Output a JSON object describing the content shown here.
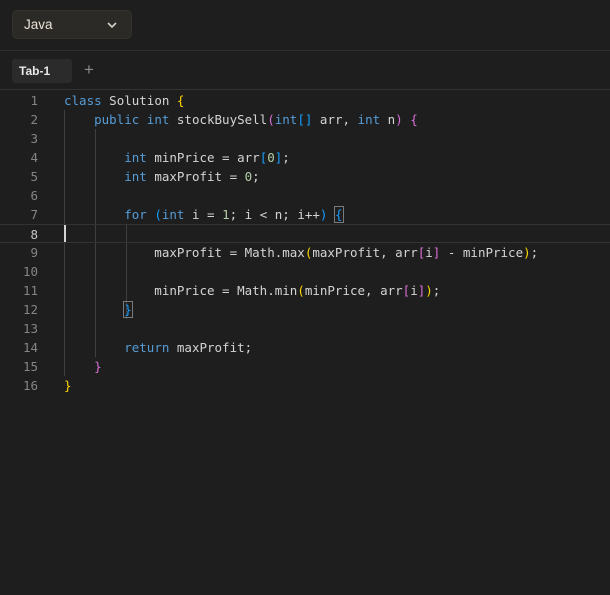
{
  "language_selector": {
    "value": "Java"
  },
  "tabs": [
    {
      "label": "Tab-1"
    }
  ],
  "add_tab_label": "+",
  "editor": {
    "active_line": 8,
    "lines": [
      {
        "number": "1",
        "text": "class Solution {"
      },
      {
        "number": "2",
        "text": "    public int stockBuySell(int[] arr, int n) {"
      },
      {
        "number": "3",
        "text": ""
      },
      {
        "number": "4",
        "text": "        int minPrice = arr[0];"
      },
      {
        "number": "5",
        "text": "        int maxProfit = 0;"
      },
      {
        "number": "6",
        "text": ""
      },
      {
        "number": "7",
        "text": "        for (int i = 1; i < n; i++) {"
      },
      {
        "number": "8",
        "text": ""
      },
      {
        "number": "9",
        "text": "            maxProfit = Math.max(maxProfit, arr[i] - minPrice);"
      },
      {
        "number": "10",
        "text": ""
      },
      {
        "number": "11",
        "text": "            minPrice = Math.min(minPrice, arr[i]);"
      },
      {
        "number": "12",
        "text": "        }"
      },
      {
        "number": "13",
        "text": ""
      },
      {
        "number": "14",
        "text": "        return maxProfit;"
      },
      {
        "number": "15",
        "text": "    }"
      },
      {
        "number": "16",
        "text": "}"
      }
    ]
  }
}
